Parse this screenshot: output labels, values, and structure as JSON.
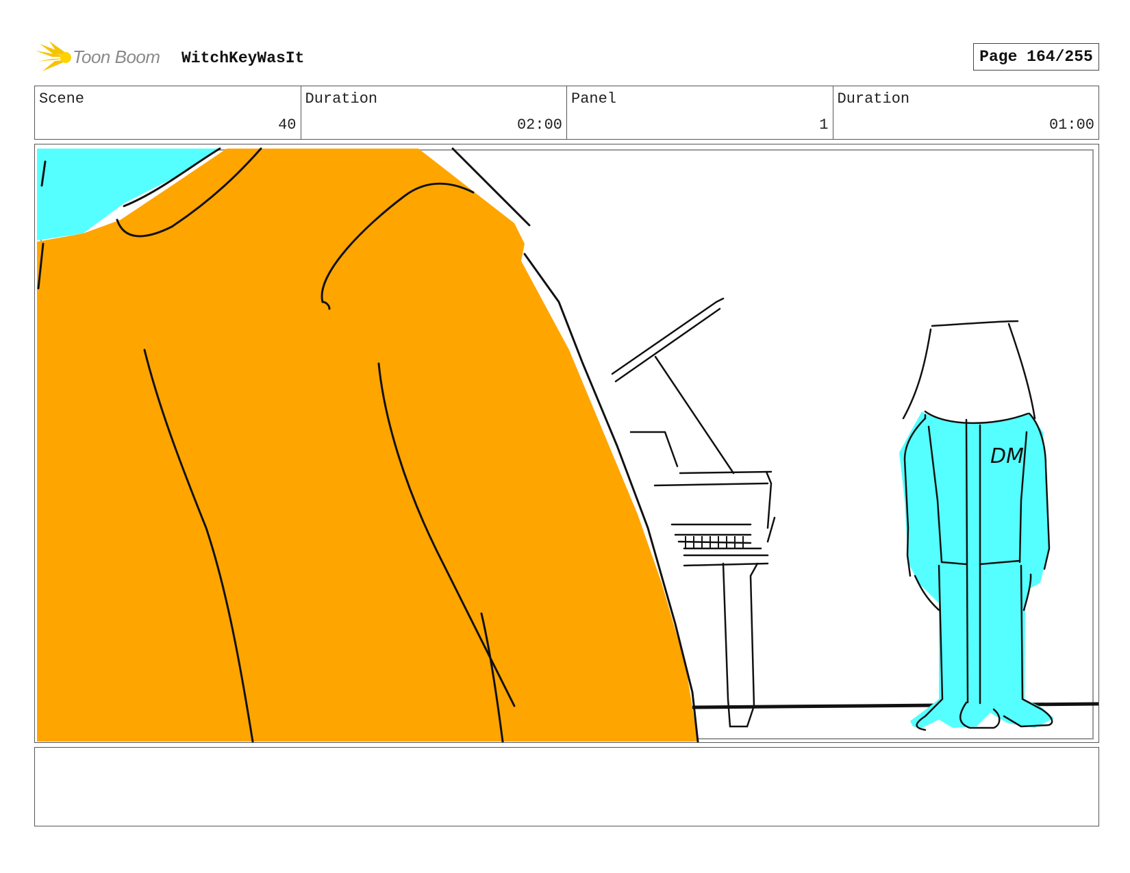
{
  "header": {
    "logo_text": "Toon Boom",
    "project_title": "WitchKeyWasIt",
    "page_label": "Page 164/255"
  },
  "info": {
    "scene_label": "Scene",
    "scene_value": "40",
    "scene_duration_label": "Duration",
    "scene_duration_value": "02:00",
    "panel_label": "Panel",
    "panel_value": "1",
    "panel_duration_label": "Duration",
    "panel_duration_value": "01:00"
  },
  "drawing": {
    "sketch_lettering": "DM",
    "colors": {
      "orange": "#FFA500",
      "cyan": "#55FFFF",
      "ink": "#111111",
      "logo_yellow": "#F5C400"
    }
  },
  "notes": {
    "text": ""
  }
}
